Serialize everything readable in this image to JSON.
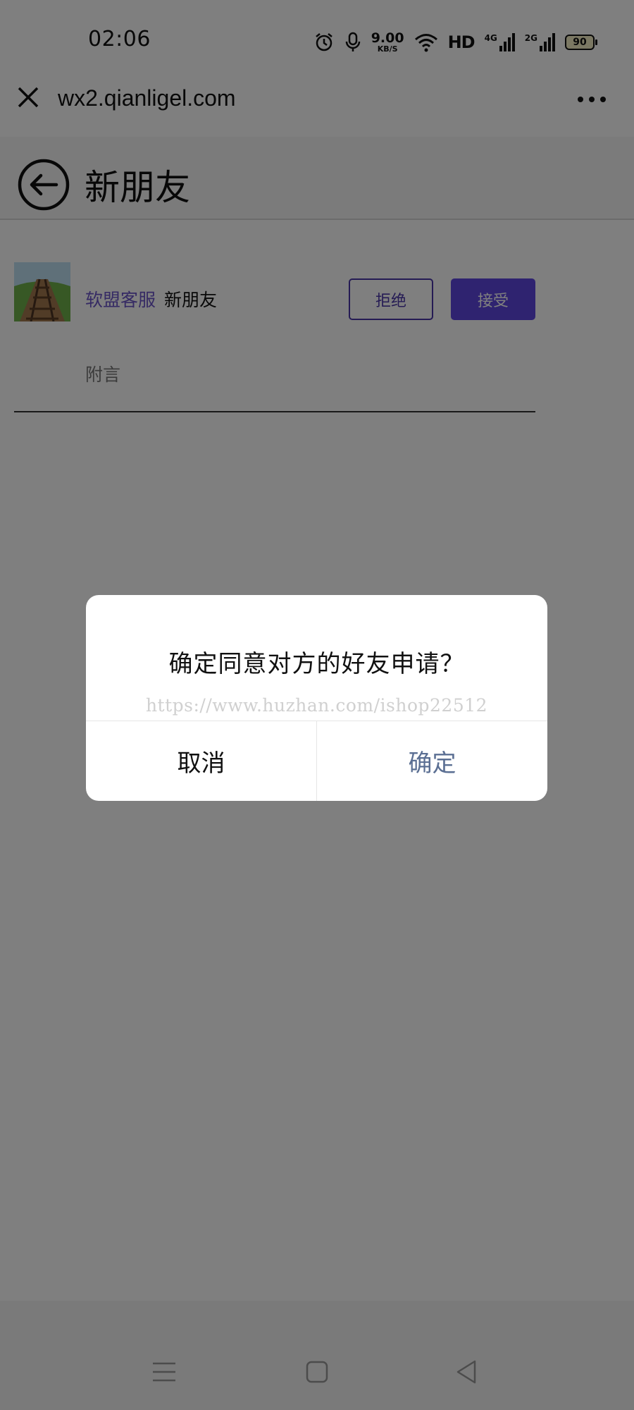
{
  "status_bar": {
    "time": "02:06",
    "net_speed_value": "9.00",
    "net_speed_unit": "KB/S",
    "hd_label": "HD",
    "sig1_label": "4G",
    "sig2_label": "2G",
    "battery_level": "90"
  },
  "browser": {
    "url": "wx2.qianligel.com"
  },
  "header": {
    "title": "新朋友"
  },
  "request": {
    "name": "软盟客服",
    "message": "新朋友",
    "reject_label": "拒绝",
    "accept_label": "接受",
    "note_label": "附言"
  },
  "dialog": {
    "message": "确定同意对方的好友申请？",
    "watermark": "https://www.huzhan.com/ishop22512",
    "cancel_label": "取消",
    "ok_label": "确定"
  },
  "colors": {
    "accent": "#5e47e0",
    "link": "#6b55c8",
    "ok_text": "#5b6f93"
  }
}
